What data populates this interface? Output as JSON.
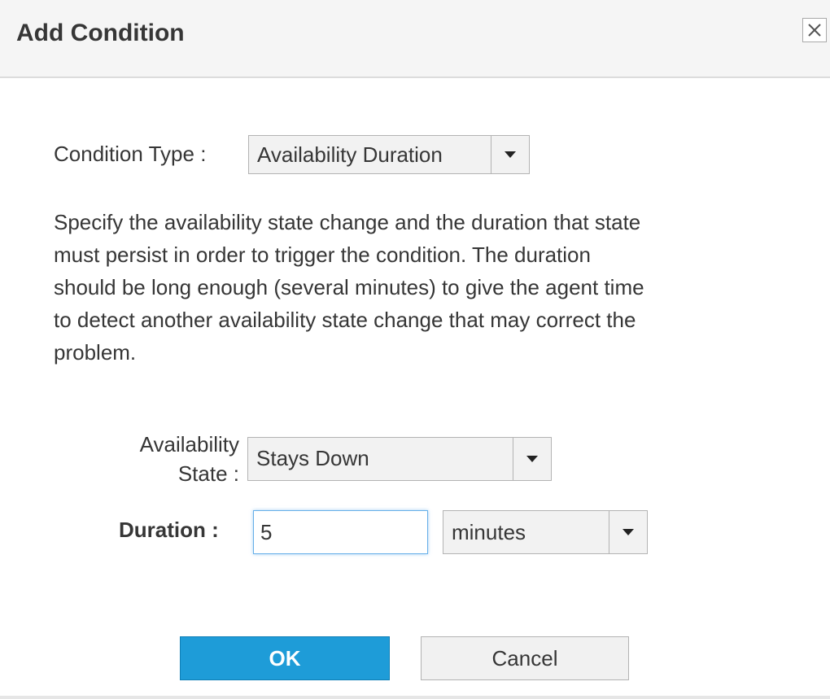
{
  "dialog": {
    "title": "Add Condition",
    "close_icon": "close-icon"
  },
  "condition_type": {
    "label": "Condition Type :",
    "value": "Availability Duration"
  },
  "description": "Specify the availability state change and the duration that state must persist in order to trigger the condition. The duration should be long enough (several minutes) to give the agent time to detect another availability state change that may correct the problem.",
  "availability_state": {
    "label_line1": "Availability",
    "label_line2": "State :",
    "value": "Stays Down"
  },
  "duration": {
    "label": "Duration :",
    "value": "5",
    "unit": "minutes"
  },
  "buttons": {
    "ok": "OK",
    "cancel": "Cancel"
  },
  "colors": {
    "primary_button": "#1e9cd8",
    "focus_border": "#66afe9"
  }
}
